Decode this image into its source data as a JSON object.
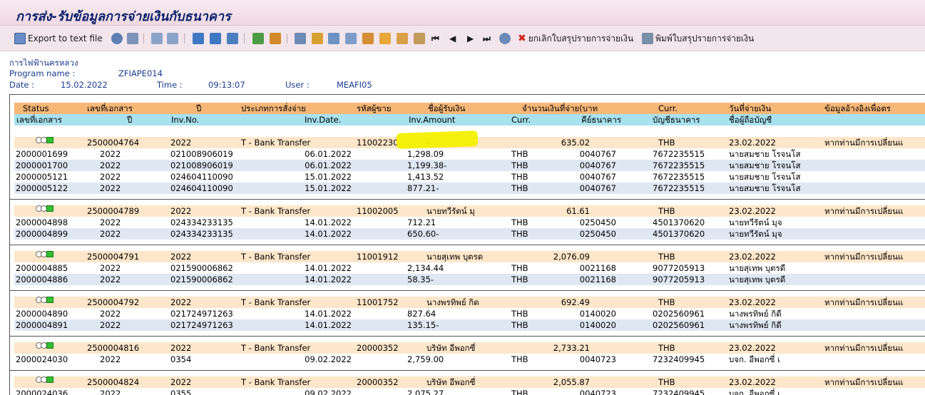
{
  "window": {
    "title": "การส่ง-รับข้อมูลการจ่ายเงินกับธนาคาร"
  },
  "toolbar": {
    "export_label": "Export to text file",
    "cancel_label": "ยกเลิกใบสรุปรายการจ่ายเงิน",
    "print_label": "พิมพ์ใบสรุปรายการจ่ายเงิน"
  },
  "info": {
    "company": "การไฟฟ้านครหลวง",
    "program_label": "Program name :",
    "program_value": "ZFIAPE014",
    "date_label": "Date :",
    "date_value": "15.02.2022",
    "time_label": "Time :",
    "time_value": "09:13:07",
    "user_label": "User :",
    "user_value": "MEAFI05"
  },
  "header1": [
    "Status",
    "เลขที่เอกสาร",
    "ปี",
    "ประเภทการสั่งจ่าย",
    "รหัสผู้ขาย",
    "ชื่อผู้รับเงิน",
    "จำนวนเงินที่จ่าย(บาท",
    "Curr.",
    "วันที่จ่ายเงิน",
    "ข้อมูลอ้างอิงเพื่อตร"
  ],
  "header2": [
    "เลขที่เอกสาร",
    "ปี",
    "Inv.No.",
    "Inv.Date.",
    "Inv.Amount",
    "Curr.",
    "คีย์ธนาคาร",
    "บัญชีธนาคาร",
    "ชื่อผู้ถือบัญชี"
  ],
  "groups": [
    {
      "doc": "2500004764",
      "year": "2022",
      "pay_type": "T - Bank Transfer",
      "vendor": "11002230",
      "payee": "-",
      "amount": "635.02",
      "curr": "THB",
      "pay_date": "23.02.2022",
      "ref": "หากท่านมีการเปลี่ยนแ",
      "items": [
        {
          "doc": "2000001699",
          "year": "2022",
          "inv_no": "021008906019",
          "inv_date": "06.01.2022",
          "inv_amt": "1,298.09",
          "curr": "THB",
          "bank_key": "0040767",
          "account": "7672235515",
          "holder": "นายสมชาย โรจนโส"
        },
        {
          "doc": "2000001700",
          "year": "2022",
          "inv_no": "021008906019",
          "inv_date": "06.01.2022",
          "inv_amt": "1,199.38-",
          "curr": "THB",
          "bank_key": "0040767",
          "account": "7672235515",
          "holder": "นายสมชาย โรจนโส"
        },
        {
          "doc": "2000005121",
          "year": "2022",
          "inv_no": "024604110090",
          "inv_date": "15.01.2022",
          "inv_amt": "1,413.52",
          "curr": "THB",
          "bank_key": "0040767",
          "account": "7672235515",
          "holder": "นายสมชาย โรจนโส"
        },
        {
          "doc": "2000005122",
          "year": "2022",
          "inv_no": "024604110090",
          "inv_date": "15.01.2022",
          "inv_amt": "877.21-",
          "curr": "THB",
          "bank_key": "0040767",
          "account": "7672235515",
          "holder": "นายสมชาย โรจนโส"
        }
      ]
    },
    {
      "doc": "2500004789",
      "year": "2022",
      "pay_type": "T - Bank Transfer",
      "vendor": "11002005",
      "payee": "นายทวีรัตน์ มุ",
      "amount": "61.61",
      "curr": "THB",
      "pay_date": "23.02.2022",
      "ref": "หากท่านมีการเปลี่ยนแ",
      "items": [
        {
          "doc": "2000004898",
          "year": "2022",
          "inv_no": "024334233135",
          "inv_date": "14.01.2022",
          "inv_amt": "712.21",
          "curr": "THB",
          "bank_key": "0250450",
          "account": "4501370620",
          "holder": "นายทวีรัตน์ มุจ"
        },
        {
          "doc": "2000004899",
          "year": "2022",
          "inv_no": "024334233135",
          "inv_date": "14.01.2022",
          "inv_amt": "650.60-",
          "curr": "THB",
          "bank_key": "0250450",
          "account": "4501370620",
          "holder": "นายทวีรัตน์ มุจ"
        }
      ]
    },
    {
      "doc": "2500004791",
      "year": "2022",
      "pay_type": "T - Bank Transfer",
      "vendor": "11001912",
      "payee": "นายสุเทพ บุตรด",
      "amount": "2,076.09",
      "curr": "THB",
      "pay_date": "23.02.2022",
      "ref": "หากท่านมีการเปลี่ยนแ",
      "items": [
        {
          "doc": "2000004885",
          "year": "2022",
          "inv_no": "021590006862",
          "inv_date": "14.01.2022",
          "inv_amt": "2,134.44",
          "curr": "THB",
          "bank_key": "0021168",
          "account": "9077205913",
          "holder": "นายสุเทพ บุตรดี"
        },
        {
          "doc": "2000004886",
          "year": "2022",
          "inv_no": "021590006862",
          "inv_date": "14.01.2022",
          "inv_amt": "58.35-",
          "curr": "THB",
          "bank_key": "0021168",
          "account": "9077205913",
          "holder": "นายสุเทพ บุตรดี"
        }
      ]
    },
    {
      "doc": "2500004792",
      "year": "2022",
      "pay_type": "T - Bank Transfer",
      "vendor": "11001752",
      "payee": "นางพรทิพย์ กิด",
      "amount": "692.49",
      "curr": "THB",
      "pay_date": "23.02.2022",
      "ref": "หากท่านมีการเปลี่ยนแ",
      "items": [
        {
          "doc": "2000004890",
          "year": "2022",
          "inv_no": "021724971263",
          "inv_date": "14.01.2022",
          "inv_amt": "827.64",
          "curr": "THB",
          "bank_key": "0140020",
          "account": "0202560961",
          "holder": "นางพรทิพย์ กิดี"
        },
        {
          "doc": "2000004891",
          "year": "2022",
          "inv_no": "021724971263",
          "inv_date": "14.01.2022",
          "inv_amt": "135.15-",
          "curr": "THB",
          "bank_key": "0140020",
          "account": "0202560961",
          "holder": "นางพรทิพย์ กิดี"
        }
      ]
    },
    {
      "doc": "2500004816",
      "year": "2022",
      "pay_type": "T - Bank Transfer",
      "vendor": "20000352",
      "payee": "บริษัท อีพอกซี่",
      "amount": "2,733.21",
      "curr": "THB",
      "pay_date": "23.02.2022",
      "ref": "หากท่านมีการเปลี่ยนแ",
      "items": [
        {
          "doc": "2000024030",
          "year": "2022",
          "inv_no": "0354",
          "inv_date": "09.02.2022",
          "inv_amt": "2,759.00",
          "curr": "THB",
          "bank_key": "0040723",
          "account": "7232409945",
          "holder": "บจก. อีพอกซี่ เ"
        }
      ]
    },
    {
      "doc": "2500004824",
      "year": "2022",
      "pay_type": "T - Bank Transfer",
      "vendor": "20000352",
      "payee": "บริษัท อีพอกซี่",
      "amount": "2,055.87",
      "curr": "THB",
      "pay_date": "23.02.2022",
      "ref": "หากท่านมีการเปลี่ยนแ",
      "items": [
        {
          "doc": "2000024036",
          "year": "2022",
          "inv_no": "0355",
          "inv_date": "09.02.2022",
          "inv_amt": "2,075.27",
          "curr": "THB",
          "bank_key": "0040723",
          "account": "7232409945",
          "holder": "บจก. อีพอกซี่ เ"
        }
      ]
    }
  ]
}
